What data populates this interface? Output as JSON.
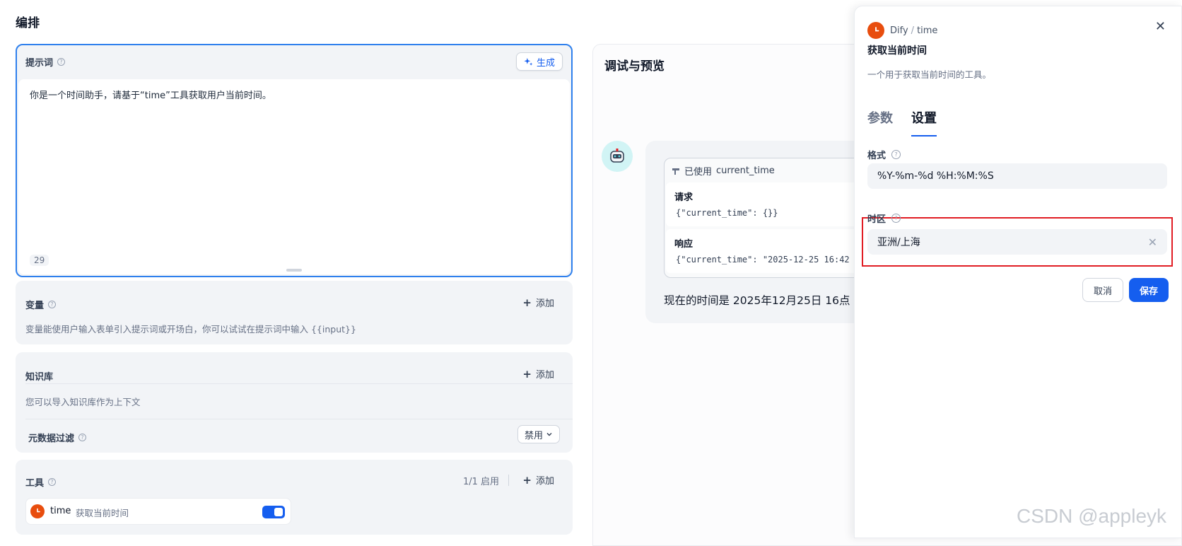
{
  "page_title": "编排",
  "prompt": {
    "label": "提示词",
    "generate_label": "生成",
    "text": "你是一个时间助手，请基于“time”工具获取用户当前时间。",
    "count": "29"
  },
  "variables": {
    "label": "变量",
    "add_label": "添加",
    "description": "变量能使用户输入表单引入提示词或开场白，你可以试试在提示词中输入 {{input}}"
  },
  "knowledge": {
    "label": "知识库",
    "add_label": "添加",
    "description": "您可以导入知识库作为上下文",
    "metadata_filter_label": "元数据过滤",
    "metadata_filter_value": "禁用"
  },
  "tools": {
    "label": "工具",
    "enabled_count": "1/1 启用",
    "add_label": "添加",
    "item": {
      "name": "time",
      "description": "获取当前时间",
      "enabled": true
    }
  },
  "preview": {
    "title": "调试与预览",
    "tool_used_prefix": "已使用",
    "tool_used_name": "current_time",
    "request_label": "请求",
    "request_code": "{\"current_time\": {}}",
    "response_label": "响应",
    "response_code": "{\"current_time\": \"2025-12-25 16:42",
    "answer": "现在的时间是 2025年12月25日 16点"
  },
  "drawer": {
    "provider": "Dify",
    "separator": "/",
    "tool_name": "time",
    "title": "获取当前时间",
    "description": "一个用于获取当前时间的工具。",
    "tabs": [
      "参数",
      "设置"
    ],
    "active_tab": "设置",
    "format_label": "格式",
    "format_value": "%Y-%m-%d %H:%M:%S",
    "timezone_label": "时区",
    "timezone_value": "亚洲/上海",
    "cancel_label": "取消",
    "save_label": "保存"
  },
  "colors": {
    "accent": "#155eef",
    "tool_logo": "#e84d0e",
    "highlight_border": "#e11d24"
  },
  "watermark": "CSDN @appleyk"
}
